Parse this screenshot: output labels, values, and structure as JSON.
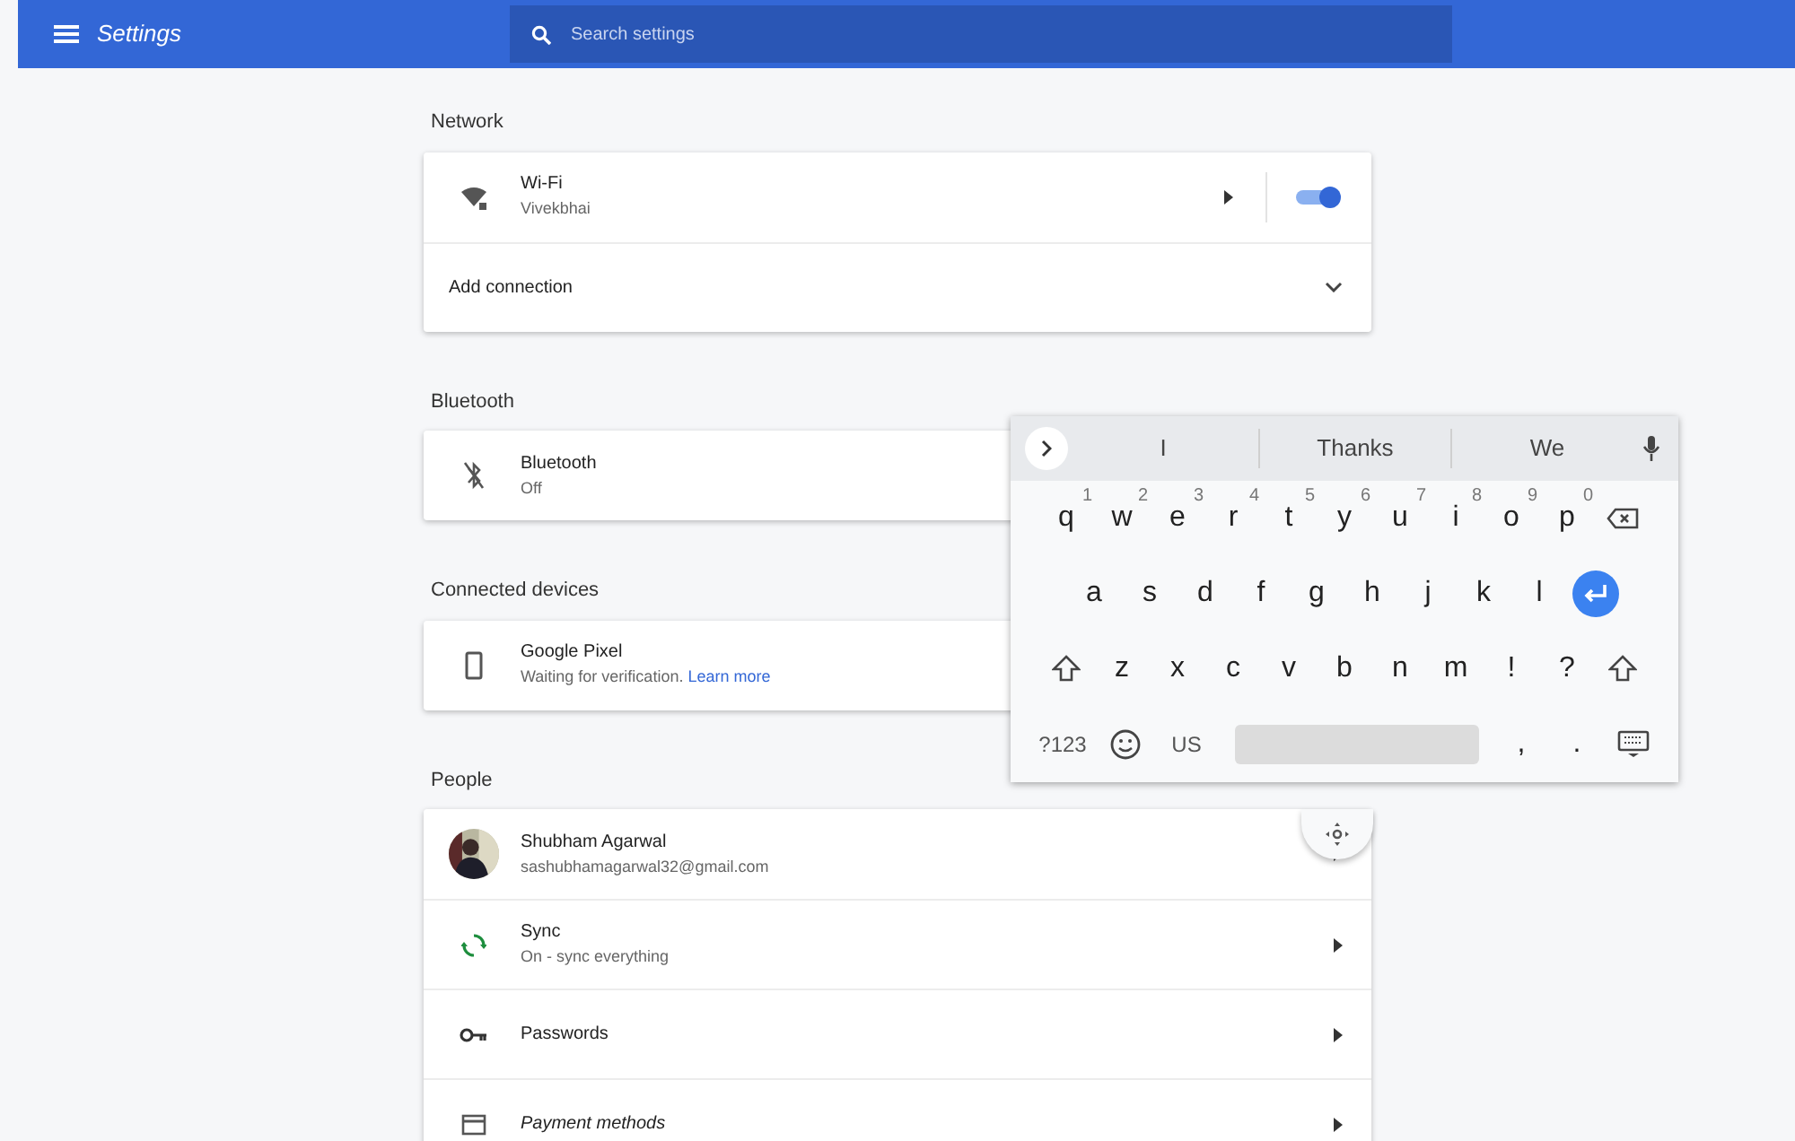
{
  "header": {
    "title": "Settings",
    "search": {
      "placeholder": "Search settings"
    }
  },
  "sections": [
    {
      "heading": "Network",
      "rows": [
        {
          "kind": "wifi",
          "title": "Wi-Fi",
          "subtitle": "Vivekbhai",
          "on": true
        },
        {
          "kind": "add",
          "title": "Add connection"
        }
      ]
    },
    {
      "heading": "Bluetooth",
      "rows": [
        {
          "kind": "bluetooth",
          "title": "Bluetooth",
          "subtitle": "Off"
        }
      ]
    },
    {
      "heading": "Connected devices",
      "rows": [
        {
          "kind": "device",
          "title": "Google Pixel",
          "subtitle": "Waiting for verification.",
          "link": "Learn more"
        }
      ]
    },
    {
      "heading": "People",
      "rows": [
        {
          "kind": "account",
          "title": "Shubham Agarwal",
          "subtitle": "sashubhamagarwal32@gmail.com"
        },
        {
          "kind": "sync",
          "title": "Sync",
          "subtitle": "On - sync everything"
        },
        {
          "kind": "passwords",
          "title": "Passwords"
        },
        {
          "kind": "payments",
          "title": "Payment methods"
        }
      ]
    }
  ],
  "keyboard": {
    "suggestions": [
      "I",
      "Thanks",
      "We"
    ],
    "rows": [
      [
        {
          "label": "q",
          "hint": "1"
        },
        {
          "label": "w",
          "hint": "2"
        },
        {
          "label": "e",
          "hint": "3"
        },
        {
          "label": "r",
          "hint": "4"
        },
        {
          "label": "t",
          "hint": "5"
        },
        {
          "label": "y",
          "hint": "6"
        },
        {
          "label": "u",
          "hint": "7"
        },
        {
          "label": "i",
          "hint": "8"
        },
        {
          "label": "o",
          "hint": "9"
        },
        {
          "label": "p",
          "hint": "0"
        },
        {
          "kind": "backspace"
        }
      ],
      [
        {
          "label": "a"
        },
        {
          "label": "s"
        },
        {
          "label": "d"
        },
        {
          "label": "f"
        },
        {
          "label": "g"
        },
        {
          "label": "h"
        },
        {
          "label": "j"
        },
        {
          "label": "k"
        },
        {
          "label": "l"
        },
        {
          "kind": "enter"
        }
      ],
      [
        {
          "kind": "shift"
        },
        {
          "label": "z"
        },
        {
          "label": "x"
        },
        {
          "label": "c"
        },
        {
          "label": "v"
        },
        {
          "label": "b"
        },
        {
          "label": "n"
        },
        {
          "label": "m"
        },
        {
          "label": "!"
        },
        {
          "label": "?"
        },
        {
          "kind": "shift"
        }
      ],
      [
        {
          "label": "?123"
        },
        {
          "kind": "emoji"
        },
        {
          "label": "US"
        },
        {
          "kind": "space"
        },
        {
          "label": ","
        },
        {
          "label": "."
        },
        {
          "kind": "hide"
        }
      ]
    ]
  }
}
